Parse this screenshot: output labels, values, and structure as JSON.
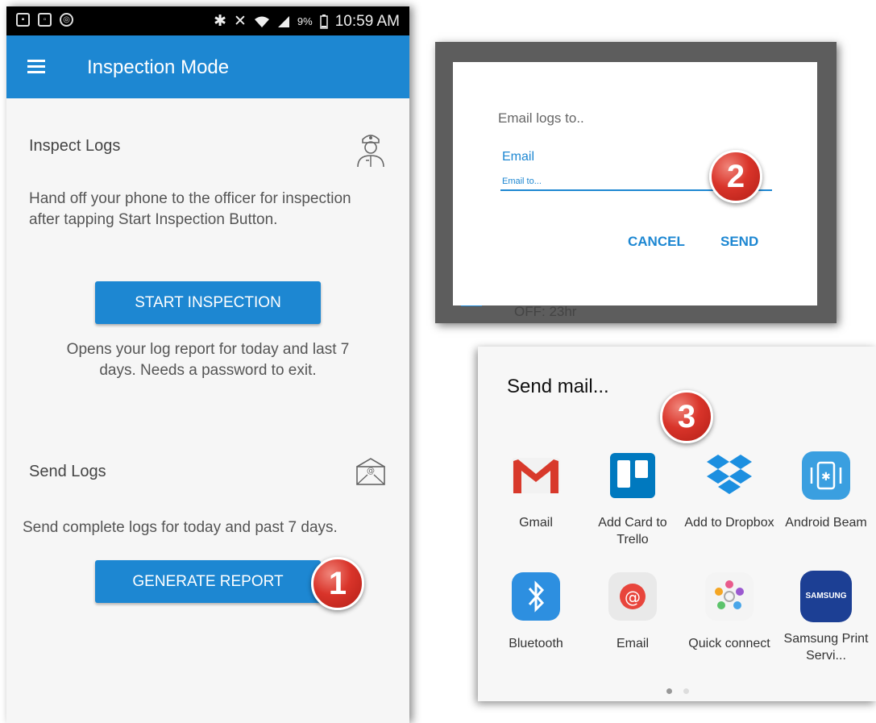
{
  "statusbar": {
    "battery": "9%",
    "time": "10:59 AM",
    "icons": [
      "gallery-icon",
      "screenshot-icon",
      "sync-icon",
      "bluetooth-icon",
      "mute-icon",
      "wifi-icon",
      "signal-icon",
      "battery-icon"
    ]
  },
  "appbar": {
    "title": "Inspection Mode"
  },
  "inspect": {
    "title": "Inspect Logs",
    "description": "Hand off your phone to the officer for inspection after tapping Start Inspection Button.",
    "button": "START INSPECTION",
    "note": "Opens your log report for today and last 7 days. Needs a password to exit."
  },
  "send": {
    "title": "Send Logs",
    "description": "Send complete logs for today and past 7 days.",
    "button": "GENERATE REPORT"
  },
  "dialog": {
    "title": "Email logs to..",
    "field_label": "Email",
    "field_placeholder": "Email to...",
    "cancel": "CANCEL",
    "send": "SEND",
    "behind_text": "OFF: 23hr"
  },
  "share": {
    "title": "Send mail...",
    "apps": [
      {
        "label": "Gmail"
      },
      {
        "label": "Add Card to Trello"
      },
      {
        "label": "Add to Dropbox"
      },
      {
        "label": "Android Beam"
      },
      {
        "label": "Bluetooth"
      },
      {
        "label": "Email"
      },
      {
        "label": "Quick connect"
      },
      {
        "label": "Samsung Print Servi..."
      }
    ],
    "samsung_logo_text": "SAMSUNG",
    "page_count": 2,
    "current_page": 1
  },
  "badges": {
    "one": "1",
    "two": "2",
    "three": "3"
  },
  "colors": {
    "primary": "#1d87d2",
    "badge": "#d9342a",
    "appbar": "#1d87d2"
  }
}
